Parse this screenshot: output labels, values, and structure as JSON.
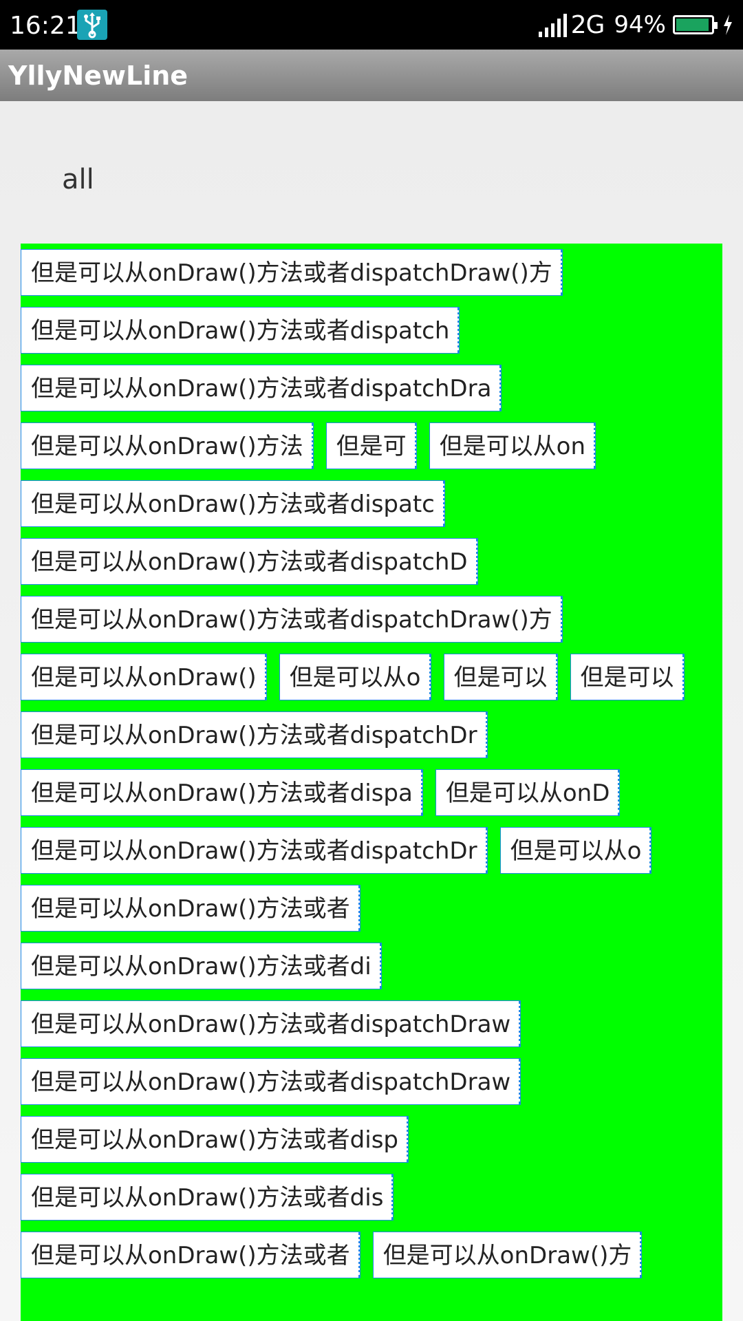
{
  "status_bar": {
    "time": "16:21",
    "network": "2G",
    "battery_percent": "94%",
    "battery_level": 0.94,
    "icons": [
      "usb-icon",
      "signal-icon",
      "battery-icon",
      "charging-icon"
    ]
  },
  "app_bar": {
    "title": "YllyNewLine"
  },
  "filter": {
    "label": "all"
  },
  "tag_rows": [
    [
      "但是可以从onDraw()方法或者dispatchDraw()方"
    ],
    [
      "但是可以从onDraw()方法或者dispatch"
    ],
    [
      "但是可以从onDraw()方法或者dispatchDra"
    ],
    [
      "但是可以从onDraw()方法",
      "但是可",
      "但是可以从on"
    ],
    [
      "但是可以从onDraw()方法或者dispatc"
    ],
    [
      "但是可以从onDraw()方法或者dispatchD"
    ],
    [
      "但是可以从onDraw()方法或者dispatchDraw()方"
    ],
    [
      "但是可以从onDraw()",
      "但是可以从o",
      "但是可以",
      "但是可以"
    ],
    [
      "但是可以从onDraw()方法或者dispatchDr"
    ],
    [
      "但是可以从onDraw()方法或者dispa",
      "但是可以从onD"
    ],
    [
      "但是可以从onDraw()方法或者dispatchDr",
      "但是可以从o"
    ],
    [
      "但是可以从onDraw()方法或者"
    ],
    [
      "但是可以从onDraw()方法或者di"
    ],
    [
      "但是可以从onDraw()方法或者dispatchDraw"
    ],
    [
      "但是可以从onDraw()方法或者dispatchDraw"
    ],
    [
      "但是可以从onDraw()方法或者disp"
    ],
    [
      "但是可以从onDraw()方法或者dis"
    ],
    [
      "但是可以从onDraw()方法或者",
      "但是可以从onDraw()方"
    ]
  ],
  "colors": {
    "tag_area_bg": "#00ff00",
    "tag_border": "#1e88e5",
    "app_bar": "#8c8c8c",
    "status_bar": "#000000"
  }
}
